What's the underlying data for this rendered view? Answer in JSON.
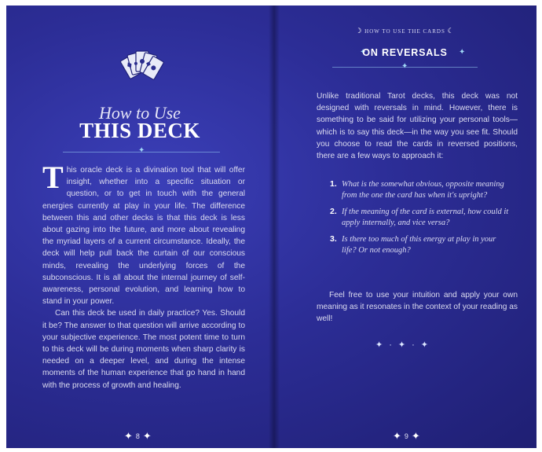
{
  "left_page": {
    "title_italic": "How to Use",
    "title_main": "THIS DECK",
    "dropcap": "T",
    "para1_rest": "his oracle deck is a divination tool that will offer insight, whether into a specific situation or question, or to get in touch with the general energies currently at play in your life. The difference between this and other decks is that this deck is less about gazing into the future, and more about revealing the myriad layers of a current circumstance. Ideally, the deck will help pull back the curtain of our conscious minds, revealing the underlying forces of the subconscious. It is all about the internal journey of self-awareness, personal evolution, and learning how to stand in your power.",
    "para2": "Can this deck be used in daily practice? Yes. Should it be? The answer to that question will arrive according to your subjective experience. The most potent time to turn to this deck will be during moments when sharp clarity is needed on a deeper level, and during the intense moments of the human experience that go hand in hand with the process of growth and healing.",
    "page_number": "8"
  },
  "right_page": {
    "running_head": "HOW TO USE THE CARDS",
    "section_title": "ON REVERSALS",
    "intro": "Unlike traditional Tarot decks, this deck was not designed with reversals in mind. However, there is something to be said for utilizing your personal tools—which is to say this deck—in the way you see fit. Should you choose to read the cards in reversed positions, there are a few ways to approach it:",
    "list": [
      {
        "num": "1.",
        "text": "What is the somewhat obvious, opposite meaning from the one the card has when it's upright?"
      },
      {
        "num": "2.",
        "text": "If the meaning of the card is external, how could it apply internally, and vice versa?"
      },
      {
        "num": "3.",
        "text": "Is there too much of this energy at play in your life? Or not enough?"
      }
    ],
    "closing": "Feel free to use your intuition and apply your own meaning as it resonates in the context of your reading as well!",
    "page_number": "9"
  },
  "colors": {
    "background": "#2c2d96",
    "accent": "#9fd6f5"
  },
  "icons": [
    "tarot-cards-icon",
    "crescent-moon-icon",
    "sparkle-icon"
  ]
}
